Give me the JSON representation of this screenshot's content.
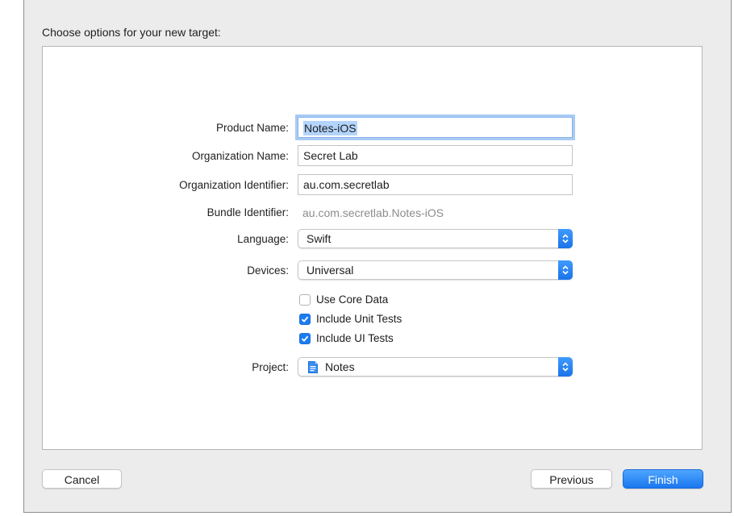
{
  "dialog": {
    "heading": "Choose options for your new target:"
  },
  "form": {
    "product_name": {
      "label": "Product Name:",
      "value": "Notes-iOS"
    },
    "organization_name": {
      "label": "Organization Name:",
      "value": "Secret Lab"
    },
    "organization_identifier": {
      "label": "Organization Identifier:",
      "value": "au.com.secretlab"
    },
    "bundle_identifier": {
      "label": "Bundle Identifier:",
      "value": "au.com.secretlab.Notes-iOS"
    },
    "language": {
      "label": "Language:",
      "selected": "Swift"
    },
    "devices": {
      "label": "Devices:",
      "selected": "Universal"
    },
    "options": [
      {
        "label": "Use Core Data",
        "checked": false
      },
      {
        "label": "Include Unit Tests",
        "checked": true
      },
      {
        "label": "Include UI Tests",
        "checked": true
      }
    ],
    "project": {
      "label": "Project:",
      "selected": "Notes",
      "icon": "project-file-icon"
    }
  },
  "buttons": {
    "cancel": "Cancel",
    "previous": "Previous",
    "finish": "Finish"
  },
  "colors": {
    "accent": "#1b7cf1",
    "focus_ring": "#a8cbf3",
    "dialog_bg": "#ececec"
  }
}
